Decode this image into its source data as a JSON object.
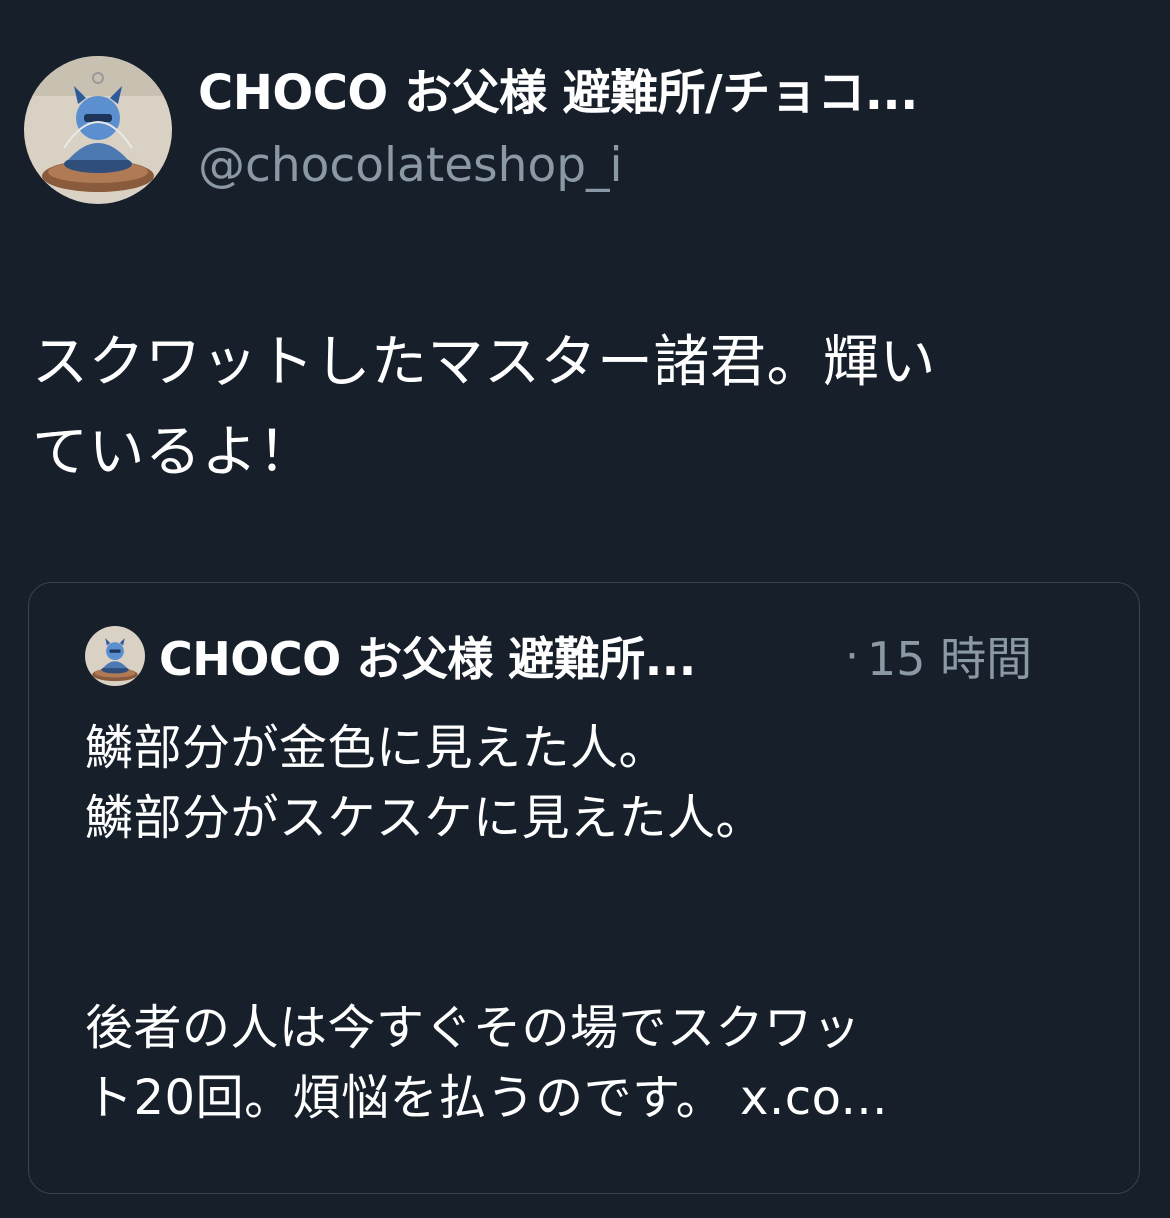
{
  "author": {
    "display_name": "CHOCO お父様 避難所/チョコ...",
    "handle": "@chocolateshop_i",
    "avatar_icon": "avatar-acrylic-stand-icon"
  },
  "tweet": {
    "line1": "スクワットしたマスター諸君。輝い",
    "line2": "ているよ！"
  },
  "quote": {
    "display_name": "CHOCO お父様 避難所...",
    "separator": "·",
    "time": "15 時間",
    "line1": "鱗部分が金色に見えた人。",
    "line2": "鱗部分がスケスケに見えた人。",
    "line3": "後者の人は今すぐその場でスクワッ",
    "line4_text": "ト20回。煩悩を払うのです。 ",
    "line4_link": "x.co..."
  },
  "colors": {
    "background": "#161f2a",
    "text": "#ffffff",
    "secondary": "#8b98a5",
    "border": "#38444d"
  }
}
